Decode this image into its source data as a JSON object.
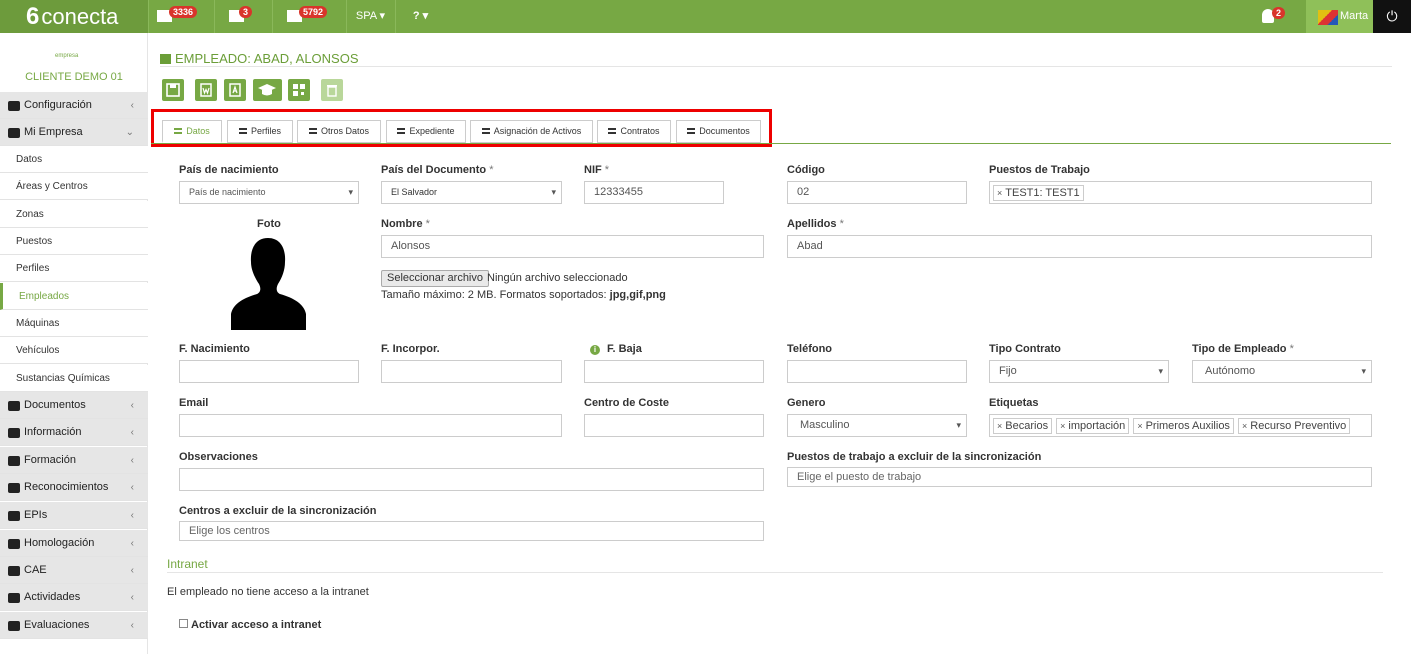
{
  "topbar": {
    "brand": "conecta",
    "brand_mark": "6",
    "badges": {
      "messages": "3336",
      "calendar": "3",
      "tasks": "5792",
      "notifications": "2"
    },
    "language": "SPA ▾",
    "help": "? ▾",
    "user": "Marta",
    "power": "⏻"
  },
  "sidebar": {
    "client_logo": "empresa",
    "client": "CLIENTE DEMO 01",
    "items": [
      {
        "label": "Configuración",
        "icon": "gear-icon"
      },
      {
        "label": "Mi Empresa",
        "icon": "company-icon"
      },
      {
        "label": "Datos"
      },
      {
        "label": "Áreas y Centros"
      },
      {
        "label": "Zonas"
      },
      {
        "label": "Puestos"
      },
      {
        "label": "Perfiles"
      },
      {
        "label": "Empleados"
      },
      {
        "label": "Máquinas"
      },
      {
        "label": "Vehículos"
      },
      {
        "label": "Sustancias Químicas"
      },
      {
        "label": "Documentos",
        "icon": "books-icon"
      },
      {
        "label": "Información",
        "icon": "newspaper-icon"
      },
      {
        "label": "Formación",
        "icon": "graduation-cap-icon"
      },
      {
        "label": "Reconocimientos",
        "icon": "heartbeat-icon"
      },
      {
        "label": "EPIs",
        "icon": "headphones-icon"
      },
      {
        "label": "Homologación",
        "icon": "ribbon-icon"
      },
      {
        "label": "CAE",
        "icon": "share-icon"
      },
      {
        "label": "Actividades",
        "icon": "calendar-icon"
      },
      {
        "label": "Evaluaciones",
        "icon": "cross-icon"
      }
    ]
  },
  "page": {
    "title": "EMPLEADO: ABAD, ALONSOS"
  },
  "tabs": [
    "Datos",
    "Perfiles",
    "Otros Datos",
    "Expediente",
    "Asignación de Activos",
    "Contratos",
    "Documentos"
  ],
  "form": {
    "pais_nac": {
      "label": "País de nacimiento",
      "value": "País de nacimiento"
    },
    "pais_doc": {
      "label": "País del Documento",
      "value": "El Salvador"
    },
    "nif": {
      "label": "NIF",
      "value": "12333455"
    },
    "codigo": {
      "label": "Código",
      "value": "02"
    },
    "puestos": {
      "label": "Puestos de Trabajo",
      "tags": [
        "TEST1: TEST1"
      ]
    },
    "foto": {
      "label": "Foto"
    },
    "nombre": {
      "label": "Nombre",
      "value": "Alonsos"
    },
    "apellidos": {
      "label": "Apellidos",
      "value": "Abad"
    },
    "file_button": "Seleccionar archivo",
    "file_status": "Ningún archivo seleccionado",
    "file_hint": "Tamaño máximo: 2 MB. Formatos soportados:",
    "file_formats": "jpg,gif,png",
    "f_nac": {
      "label": "F. Nacimiento"
    },
    "f_incorp": {
      "label": "F. Incorpor."
    },
    "f_baja": {
      "label": "F. Baja"
    },
    "telefono": {
      "label": "Teléfono"
    },
    "tipo_contrato": {
      "label": "Tipo Contrato",
      "value": "Fijo"
    },
    "tipo_empleado": {
      "label": "Tipo de Empleado",
      "value": "Autónomo"
    },
    "email": {
      "label": "Email"
    },
    "centro_coste": {
      "label": "Centro de Coste"
    },
    "genero": {
      "label": "Genero",
      "value": "Masculino"
    },
    "etiquetas": {
      "label": "Etiquetas",
      "tags": [
        "Becarios",
        "importación",
        "Primeros Auxilios",
        "Recurso Preventivo"
      ]
    },
    "observaciones": {
      "label": "Observaciones"
    },
    "puestos_excluir": {
      "label": "Puestos de trabajo a excluir de la sincronización",
      "placeholder": "Elige el puesto de trabajo"
    },
    "centros_excluir": {
      "label": "Centros a excluir de la sincronización",
      "placeholder": "Elige los centros"
    },
    "required_mark": "*",
    "tag_remove": "×"
  },
  "intranet": {
    "title": "Intranet",
    "note": "El empleado no tiene acceso a la intranet",
    "activate": "Activar acceso a intranet"
  }
}
